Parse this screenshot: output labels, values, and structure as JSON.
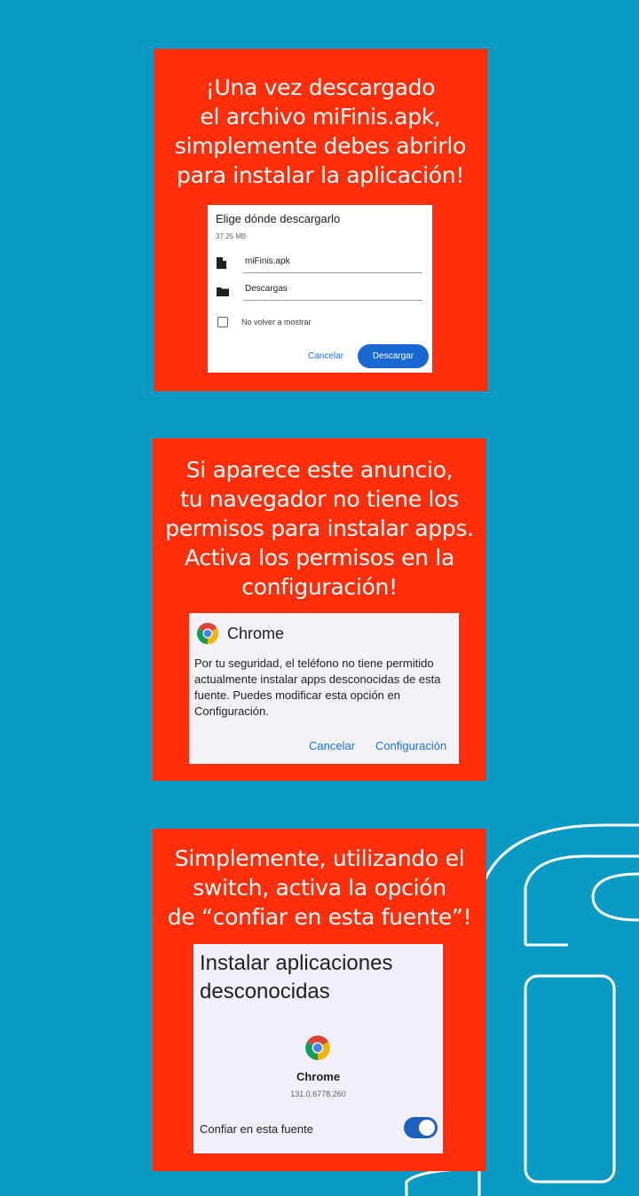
{
  "background_color": "#0a9bc4",
  "card_color": "#ff2e0a",
  "card1": {
    "heading": [
      "¡Una vez descargado",
      "el archivo miFinis.apk,",
      "simplemente debes abrirlo",
      "para instalar la aplicación!"
    ],
    "dialog": {
      "title": "Elige dónde descargarlo",
      "size": "37.25 MB",
      "file_icon": "file-icon",
      "file_name": "miFinis.apk",
      "folder_icon": "folder-icon",
      "folder_name": "Descargas",
      "checkbox_label": "No volver a mostrar",
      "cancel_label": "Cancelar",
      "download_label": "Descargar"
    }
  },
  "card2": {
    "heading": [
      "Si aparece este anuncio,",
      "tu navegador no tiene los",
      "permisos para instalar apps.",
      "Activa los permisos en la",
      "configuración!"
    ],
    "dialog": {
      "app_icon": "chrome-icon",
      "app_name": "Chrome",
      "message": "Por tu seguridad, el teléfono no tiene permitido actualmente instalar apps desconocidas de esta fuente. Puedes modificar esta opción en Configuración.",
      "cancel_label": "Cancelar",
      "settings_label": "Configuración"
    }
  },
  "card3": {
    "heading": [
      "Simplemente, utilizando el",
      "switch, activa la opción",
      "de  “confiar en esta fuente”!"
    ],
    "screen": {
      "title_lines": [
        "Instalar aplicaciones",
        "desconocidas"
      ],
      "app_icon": "chrome-icon",
      "app_name": "Chrome",
      "version": "131.0.6778.260",
      "toggle_label": "Confiar en esta fuente",
      "toggle_on": true
    }
  }
}
